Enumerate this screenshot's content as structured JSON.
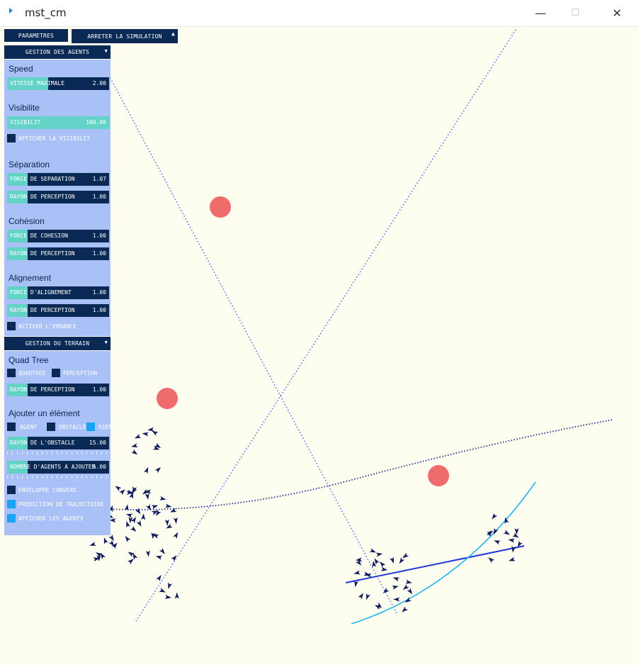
{
  "window": {
    "title": "mst_cm",
    "minimize": "—",
    "maximize": "☐",
    "close": "✕"
  },
  "toolbar": {
    "params_label": "PARAMETRES",
    "stop_label": "ARRETER LA SIMULATION",
    "agents_group": "GESTION DES AGENTS",
    "terrain_group": "GESTION DU TERRAIN"
  },
  "agents_panel": {
    "speed_title": "Speed",
    "speed_slider": {
      "label": "VITESSE MAXIMALE",
      "value": "2.00",
      "fill": 0.4
    },
    "visibility_title": "Visibilite",
    "visibility_slider": {
      "label": "VISIBILIT",
      "value": "100.00",
      "fill": 1.0
    },
    "show_visibility": "AFFICHER LA VISIBILIT",
    "separation_title": "Séparation",
    "sep_force": {
      "label": "FORCE DE SEPARATION",
      "value": "1.07",
      "fill": 0.2
    },
    "sep_radius": {
      "label": "RAYON DE PERCEPTION",
      "value": "1.00",
      "fill": 0.2
    },
    "cohesion_title": "Cohésion",
    "coh_force": {
      "label": "FORCE DE COHESION",
      "value": "1.00",
      "fill": 0.2
    },
    "coh_radius": {
      "label": "RAYON DE PERCEPTION",
      "value": "1.00",
      "fill": 0.2
    },
    "alignment_title": "Alignement",
    "ali_force": {
      "label": "FORCE D'ALIGNEMENT",
      "value": "1.00",
      "fill": 0.2
    },
    "ali_radius": {
      "label": "RAYON DE PERCEPTION",
      "value": "1.00",
      "fill": 0.2
    },
    "wander": "ACTIVER L'ERRANCE"
  },
  "terrain_panel": {
    "quadtree_title": "Quad Tree",
    "quadtree": "QUADTREE",
    "perception": "PERCEPTION",
    "qt_radius": {
      "label": "RAYON DE PERCEPTION",
      "value": "1.00",
      "fill": 0.2
    },
    "add_title": "Ajouter un élément",
    "agent": "AGENT",
    "obstacle": "OBSTACLE",
    "nothing": "RIEN",
    "obstacle_radius": {
      "label": "RAYON DE L'OBSTACLE",
      "value": "15.00",
      "fill": 0.2
    },
    "agents_to_add": {
      "label": "NOMBRE D'AGENTS A AJOUTER",
      "value": "5.00",
      "fill": 0.2
    },
    "convex_hull": "ENVELOPPE CONVEXE",
    "trajectory": "PREDICTION DE TRAJECTOIRE",
    "show_agents": "AFFICHER LES AGENTS"
  },
  "colors": {
    "background": "#fdfdf0",
    "panel": "#a9c1f7",
    "button": "#0a2a55",
    "slider_fill": "#62d3c6",
    "obstacle": "#f06b6b",
    "agent": "#0e1a5c",
    "path_light": "#1fb3f0",
    "path_blue": "#2236d8",
    "path_dotted": "#4a6cf0",
    "path_dark": "#2a2a90"
  },
  "scene": {
    "obstacle_count": 3,
    "agent_count": 117
  }
}
